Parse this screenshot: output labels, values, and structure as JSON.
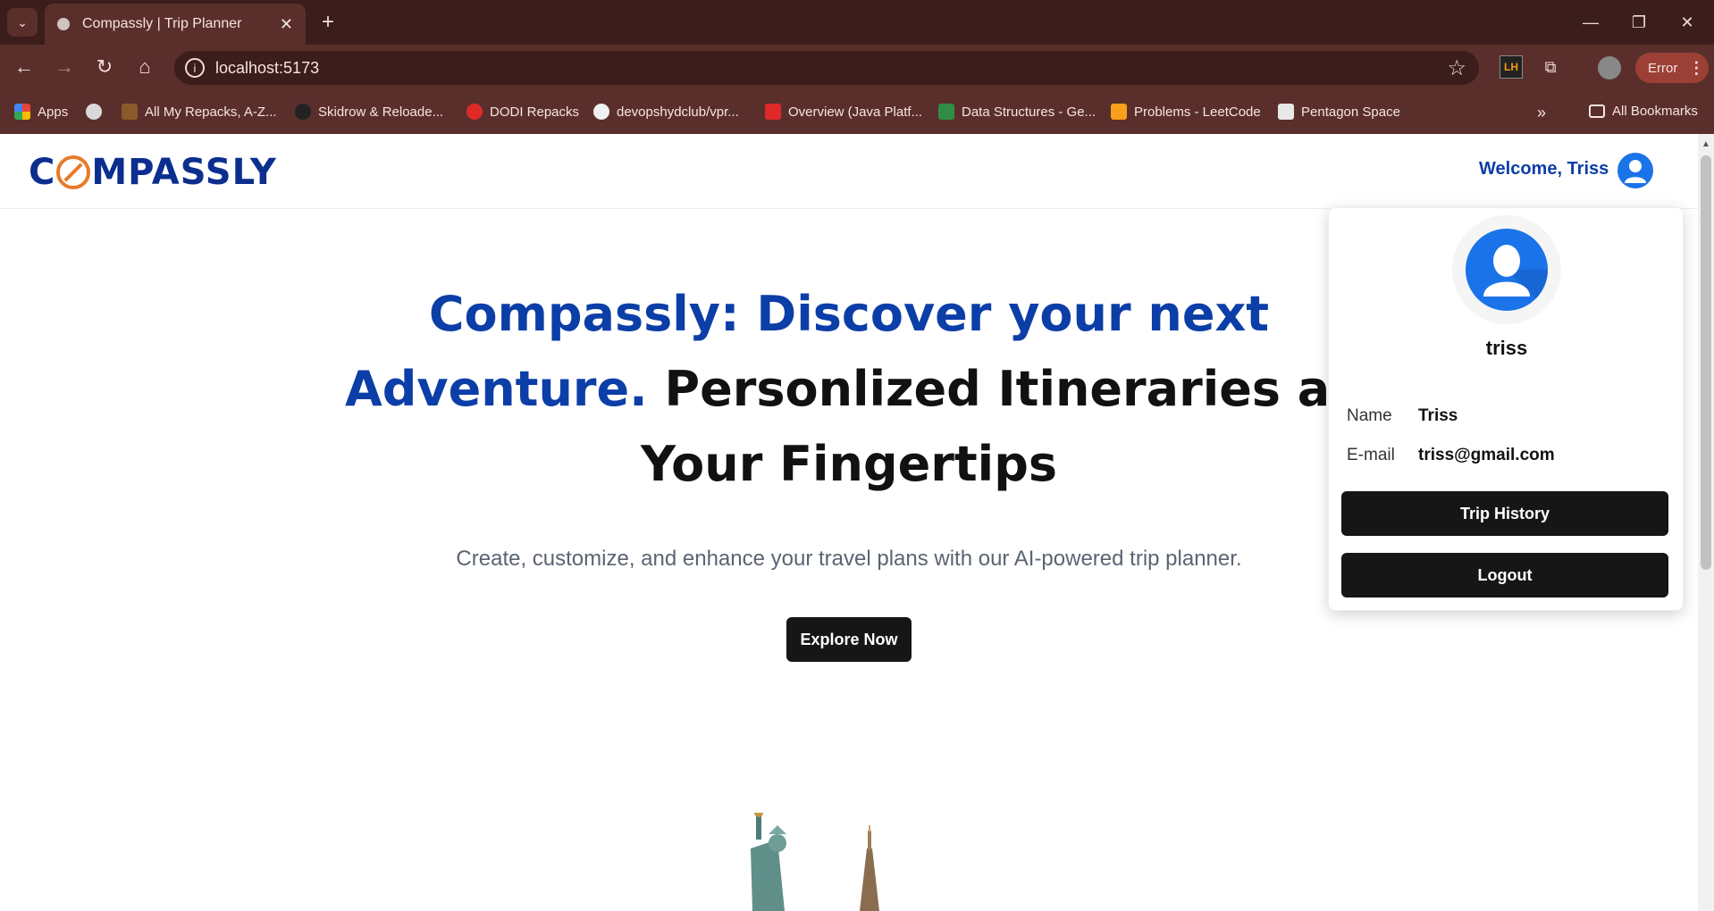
{
  "browser": {
    "tab_title": "Compassly | Trip Planner",
    "url": "localhost:5173",
    "error_label": "Error",
    "bookmarks": [
      {
        "label": "Apps",
        "icon": "apps-grid-icon"
      },
      {
        "label": "",
        "icon": "globe-icon"
      },
      {
        "label": "All My Repacks, A-Z...",
        "icon": "repacks-icon"
      },
      {
        "label": "Skidrow & Reloade...",
        "icon": "skidrow-icon"
      },
      {
        "label": "DODI Repacks",
        "icon": "dodi-icon"
      },
      {
        "label": "devopshydclub/vpr...",
        "icon": "github-icon"
      },
      {
        "label": "Overview (Java Platf...",
        "icon": "oracle-icon"
      },
      {
        "label": "Data Structures - Ge...",
        "icon": "geeksforgeeks-icon"
      },
      {
        "label": "Problems - LeetCode",
        "icon": "leetcode-icon"
      },
      {
        "label": "Pentagon Space",
        "icon": "pentagon-icon"
      }
    ],
    "all_bookmarks_label": "All Bookmarks",
    "extension_lh_label": "LH"
  },
  "header": {
    "logo_text_left": "C",
    "logo_text_right": "MPASSLY",
    "welcome": "Welcome, Triss"
  },
  "hero": {
    "title_blue": "Compassly: Discover your next Adventure.",
    "title_black": "Personlized Itineraries at Your Fingertips",
    "subtitle": "Create, customize, and enhance your travel plans with our AI-powered trip planner.",
    "cta": "Explore Now"
  },
  "profile_menu": {
    "username": "triss",
    "name_label": "Name",
    "name_value": "Triss",
    "email_label": "E-mail",
    "email_value": "triss@gmail.com",
    "trip_history": "Trip History",
    "logout": "Logout"
  },
  "colors": {
    "brand_blue": "#0c3ea8",
    "accent_orange": "#e87a2d",
    "button_dark": "#161616",
    "chrome_dark": "#3b1d1b",
    "chrome_mid": "#5a2f2b"
  }
}
